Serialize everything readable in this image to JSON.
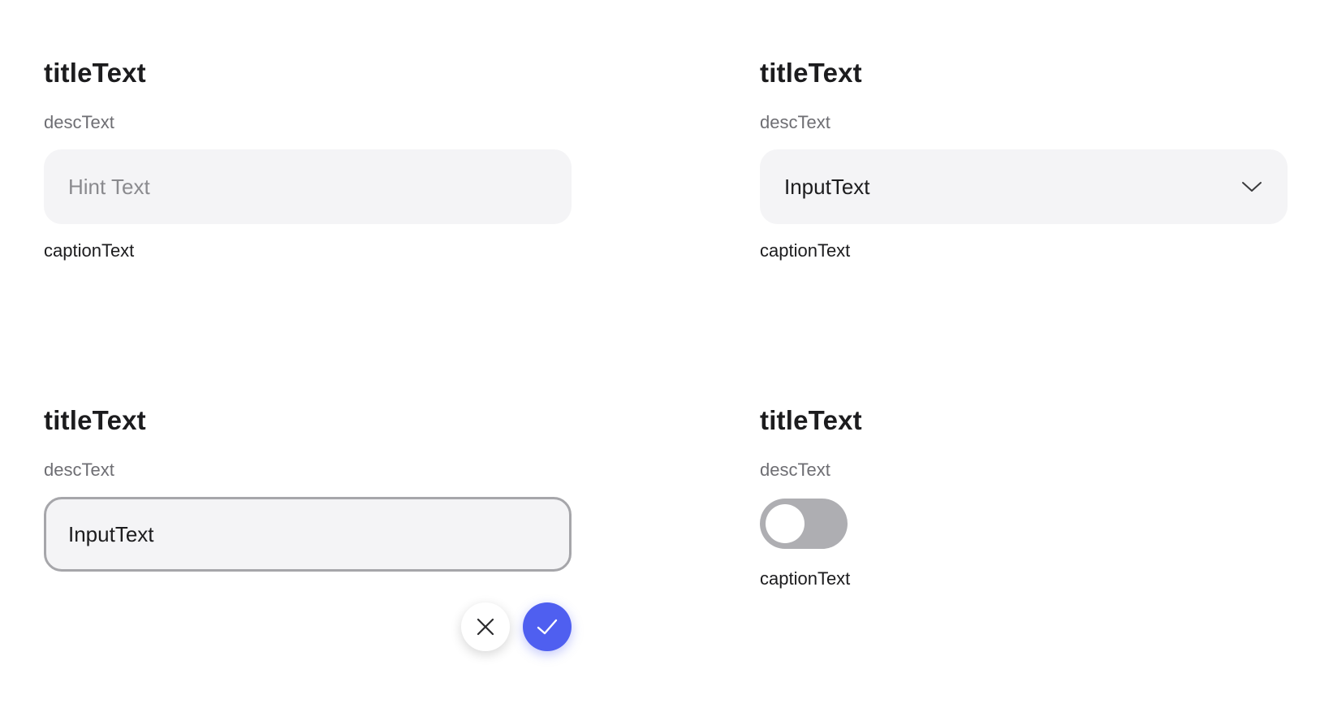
{
  "sections": [
    {
      "title": "titleText",
      "desc": "descText",
      "field": {
        "type": "text",
        "placeholder": "Hint Text",
        "value": ""
      },
      "caption": "captionText"
    },
    {
      "title": "titleText",
      "desc": "descText",
      "field": {
        "type": "dropdown",
        "value": "InputText",
        "icon": "chevron-down-icon"
      },
      "caption": "captionText"
    },
    {
      "title": "titleText",
      "desc": "descText",
      "field": {
        "type": "text",
        "state": "focused",
        "value": "InputText"
      },
      "actions": {
        "cancel_icon": "close-icon",
        "confirm_icon": "check-icon"
      }
    },
    {
      "title": "titleText",
      "desc": "descText",
      "toggle": {
        "on": false
      },
      "caption": "captionText"
    }
  ],
  "colors": {
    "accent": "#4f5ff0",
    "field_bg": "#f4f4f6",
    "toggle_off": "#aeaeb2",
    "focus_border": "#a6a6aa"
  }
}
